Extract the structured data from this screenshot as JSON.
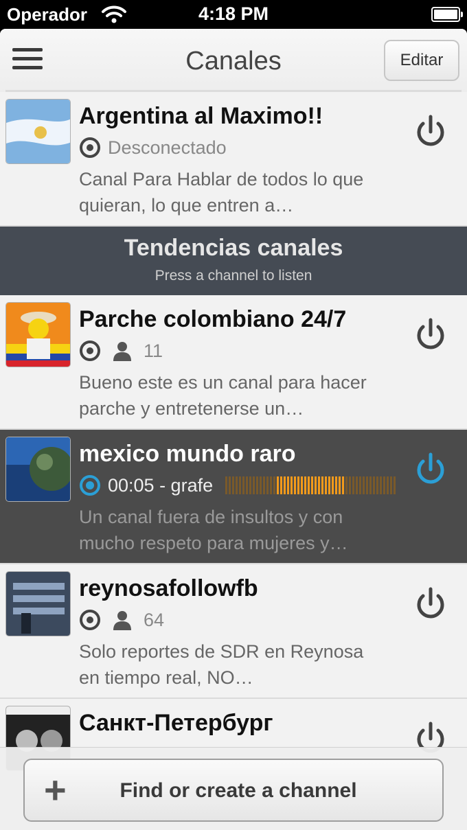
{
  "status_bar": {
    "carrier": "Operador",
    "time": "4:18 PM"
  },
  "navbar": {
    "title": "Canales",
    "edit_label": "Editar"
  },
  "section": {
    "title": "Tendencias canales",
    "subtitle": "Press a channel to listen"
  },
  "channels": [
    {
      "title": "Argentina al Maximo!!",
      "status": "Desconectado",
      "description": "Canal Para Hablar de todos lo que quieran, lo que entren a…"
    },
    {
      "title": "Parche colombiano 24/7",
      "listeners": "11",
      "description": "Bueno este es un canal para hacer parche y entretenerse un…"
    },
    {
      "title": "mexico mundo raro",
      "playback": "00:05 - grafe",
      "description": "Un canal fuera de insultos y con mucho respeto para mujeres y…",
      "audio_level": 0.4
    },
    {
      "title": "reynosafollowfb",
      "listeners": "64",
      "description": "Solo reportes de SDR en Reynosa en tiempo real, NO…"
    },
    {
      "title": "Санкт-Петербург"
    }
  ],
  "bottom": {
    "find_label": "Find or create a channel"
  },
  "colors": {
    "active_accent": "#2b9fd6",
    "equalizer": "#f29a1b",
    "section_bg": "#454b54"
  }
}
